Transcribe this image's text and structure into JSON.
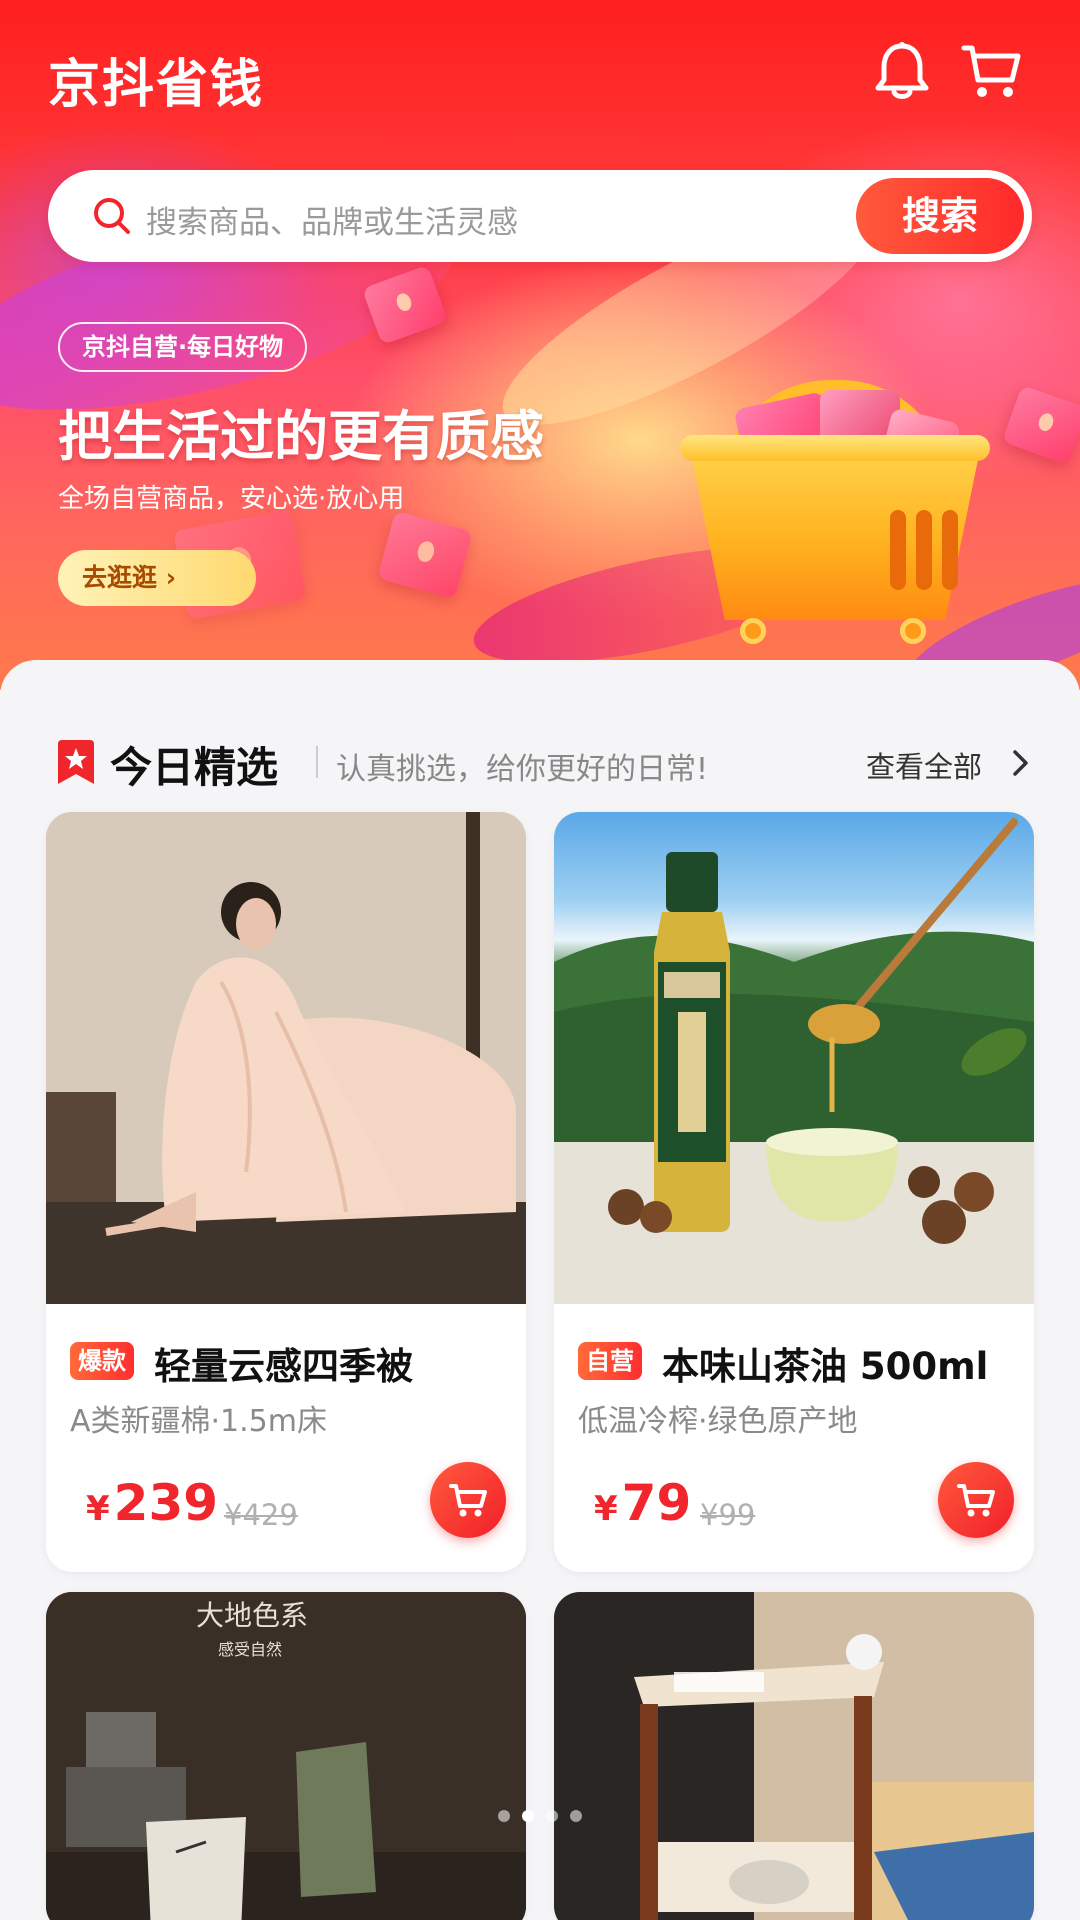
{
  "header": {
    "app_title": "京抖省钱",
    "bell_icon": "bell-icon",
    "cart_icon": "shopping-cart-icon"
  },
  "search": {
    "placeholder": "搜索商品、品牌或生活灵感",
    "button_label": "搜索",
    "icon": "search-icon"
  },
  "banner": {
    "tag": "京抖自营·每日好物",
    "headline": "把生活过的更有质感",
    "subline": "全场自营商品，安心选·放心用",
    "cta_label": "去逛逛 ›",
    "illustration": "shopping-basket-with-gifts"
  },
  "section": {
    "title": "今日精选",
    "subtitle": "认真挑选，给你更好的日常!",
    "more_label": "查看全部",
    "icon": "bookmark-star-icon"
  },
  "products": [
    {
      "badge": "爆款",
      "name": "轻量云感四季被",
      "desc": "A类新疆棉·1.5m床",
      "currency": "¥",
      "price": "239",
      "original_price": "¥429",
      "image": "woman-wrapped-in-pink-blanket"
    },
    {
      "badge": "自营",
      "name": "本味山茶油 500ml",
      "desc": "低温冷榨·绿色原产地",
      "currency": "¥",
      "price": "79",
      "original_price": "¥99",
      "image": "camellia-oil-bottle-with-honey-spoon"
    },
    {
      "image": "ceramic-mugs-on-table",
      "image_text_title": "大地色系",
      "image_text_sub": "感受自然"
    },
    {
      "image": "wooden-side-table-in-living-room"
    }
  ],
  "colors": {
    "accent_red": "#f0262c",
    "header_red": "#ff1f1f",
    "muted_text": "#8a8a8a"
  }
}
